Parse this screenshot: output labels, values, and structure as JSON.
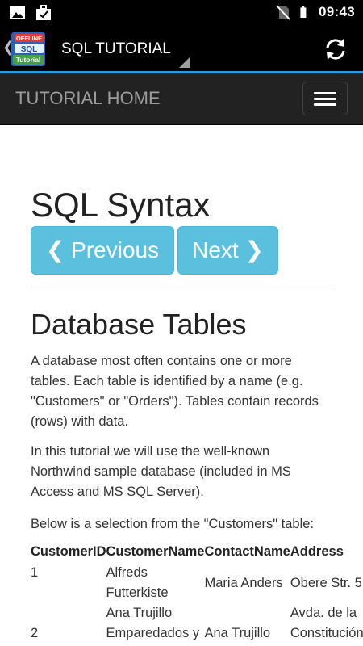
{
  "status_bar": {
    "time": "09:43",
    "left_icons": [
      "image-icon",
      "briefcase-check-icon"
    ],
    "right_icons": [
      "no-sim-icon",
      "battery-icon"
    ]
  },
  "action_bar": {
    "logo": {
      "badge_top": "OFFLINE",
      "badge_middle": "SQL",
      "badge_bottom": "Tutorial"
    },
    "title": "SQL TUTORIAL",
    "accent_color": "#2b9bd6"
  },
  "navbar": {
    "brand": "TUTORIAL HOME"
  },
  "content": {
    "page_title": "SQL Syntax",
    "prev_button": "❮ Previous",
    "next_button": "Next ❯",
    "section_title": "Database Tables",
    "paragraphs": [
      "A database most often contains one or more tables. Each table is identified by a name (e.g. \"Customers\" or \"Orders\"). Tables contain records (rows) with data.",
      "In this tutorial we will use the well-known Northwind sample database (included in MS Access and MS SQL Server).",
      "Below is a selection from the \"Customers\" table:"
    ],
    "table": {
      "headers": [
        "CustomerID",
        "CustomerName",
        "ContactName",
        "Address"
      ],
      "rows": [
        [
          "1",
          "Alfreds Futterkiste",
          "Maria Anders",
          "Obere Str. 5"
        ],
        [
          "2",
          "Ana Trujillo Emparedados y",
          "Ana Trujillo",
          "Avda. de la Constitución"
        ]
      ]
    },
    "button_color": "#5bc0de"
  }
}
